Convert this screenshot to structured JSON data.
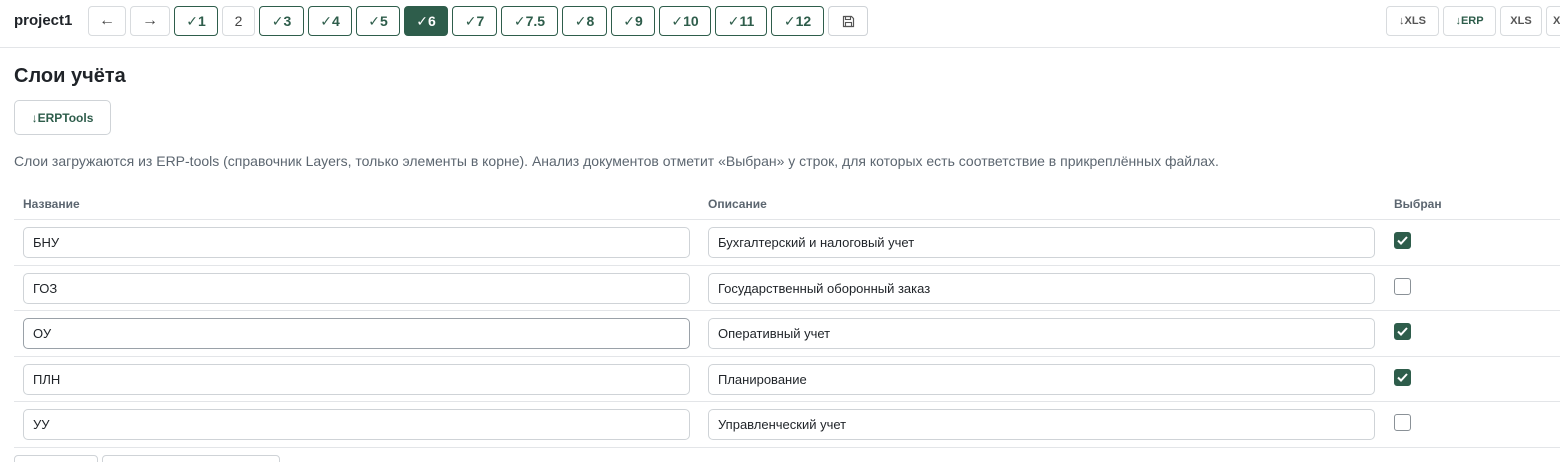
{
  "header": {
    "project": "project1",
    "back_label": "←",
    "forward_label": "→",
    "steps": [
      "✓1",
      "2",
      "✓3",
      "✓4",
      "✓5",
      "✓6",
      "✓7",
      "✓7.5",
      "✓8",
      "✓9",
      "✓10",
      "✓11",
      "✓12"
    ],
    "active_step": "✓6",
    "save_icon": "save-icon",
    "right_buttons": [
      "↓XLS",
      "↓ERP",
      "XLS",
      "X"
    ]
  },
  "page": {
    "title": "Слои учёта",
    "erptools_button": "↓ERPTools",
    "description": "Слои загружаются из ERP-tools (справочник Layers, только элементы в корне). Анализ документов отметит «Выбран» у строк, для которых есть соответствие в прикреплённых файлах."
  },
  "table": {
    "columns": [
      "Название",
      "Описание",
      "Выбран"
    ],
    "rows": [
      {
        "name": "БНУ",
        "description": "Бухгалтерский и налоговый учет",
        "selected": true
      },
      {
        "name": "ГОЗ",
        "description": "Государственный оборонный заказ",
        "selected": false
      },
      {
        "name": "ОУ",
        "description": "Оперативный учет",
        "selected": true
      },
      {
        "name": "ПЛН",
        "description": "Планирование",
        "selected": true
      },
      {
        "name": "УУ",
        "description": "Управленческий учет",
        "selected": false
      }
    ]
  },
  "colors": {
    "accent": "#2e5d4b",
    "border": "#cfd3d7",
    "muted_text": "#5c6670"
  }
}
